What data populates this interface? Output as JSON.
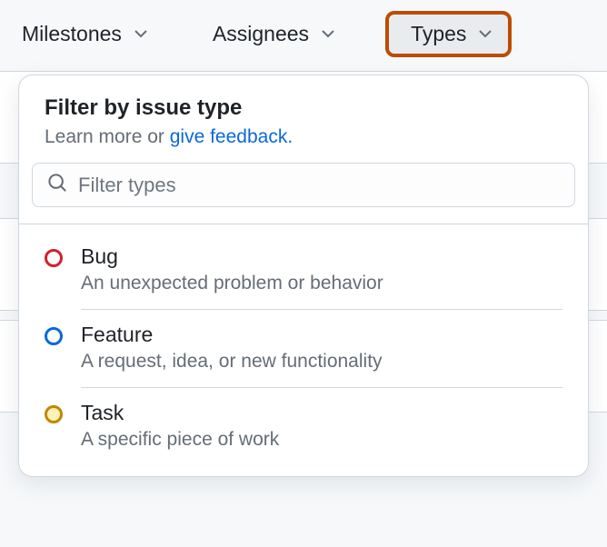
{
  "filters": {
    "milestones": "Milestones",
    "assignees": "Assignees",
    "types": "Types"
  },
  "dropdown": {
    "title": "Filter by issue type",
    "subtitle_prefix": "Learn more or ",
    "subtitle_link": "give feedback.",
    "search_placeholder": "Filter types"
  },
  "types": [
    {
      "name": "Bug",
      "desc": "An unexpected problem or behavior",
      "circle_class": "circle-red"
    },
    {
      "name": "Feature",
      "desc": "A request, idea, or new functionality",
      "circle_class": "circle-blue"
    },
    {
      "name": "Task",
      "desc": "A specific piece of work",
      "circle_class": "circle-gold"
    }
  ]
}
